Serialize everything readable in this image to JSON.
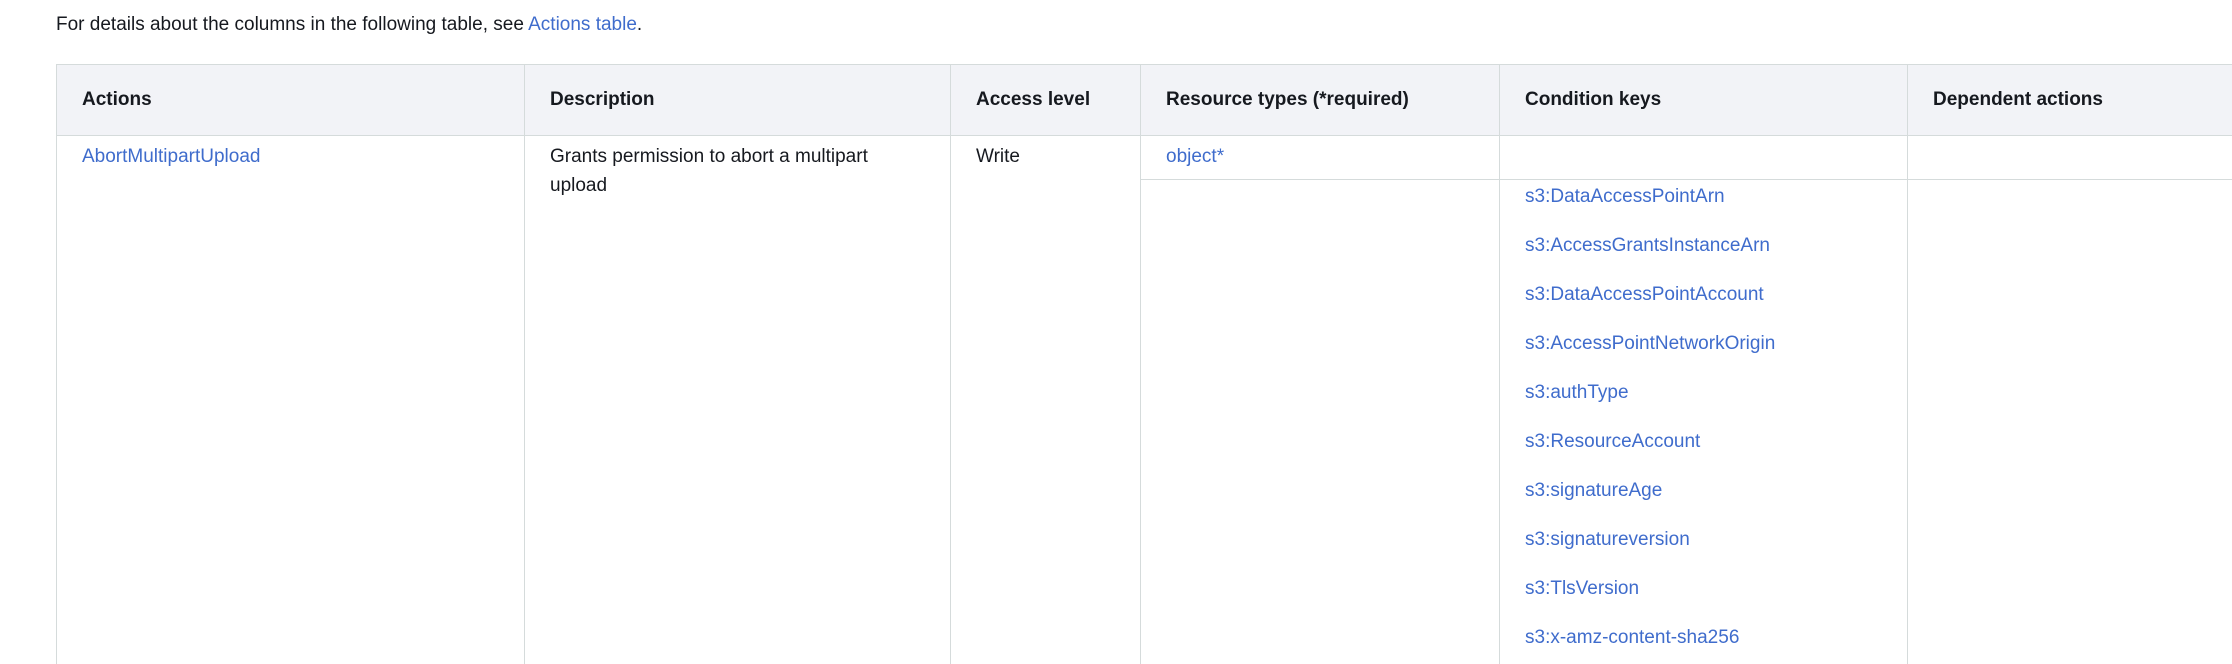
{
  "intro": {
    "text_before": "For details about the columns in the following table, see ",
    "link": "Actions table",
    "text_after": "."
  },
  "table": {
    "headers": [
      "Actions",
      "Description",
      "Access level",
      "Resource types (*required)",
      "Condition keys",
      "Dependent actions"
    ],
    "row": {
      "action": "AbortMultipartUpload",
      "description": "Grants permission to abort a multipart upload",
      "access_level": "Write",
      "resource_type": "object*",
      "condition_keys": [
        "s3:DataAccessPointArn",
        "s3:AccessGrantsInstanceArn",
        "s3:DataAccessPointAccount",
        "s3:AccessPointNetworkOrigin",
        "s3:authType",
        "s3:ResourceAccount",
        "s3:signatureAge",
        "s3:signatureversion",
        "s3:TlsVersion",
        "s3:x-amz-content-sha256"
      ]
    }
  }
}
